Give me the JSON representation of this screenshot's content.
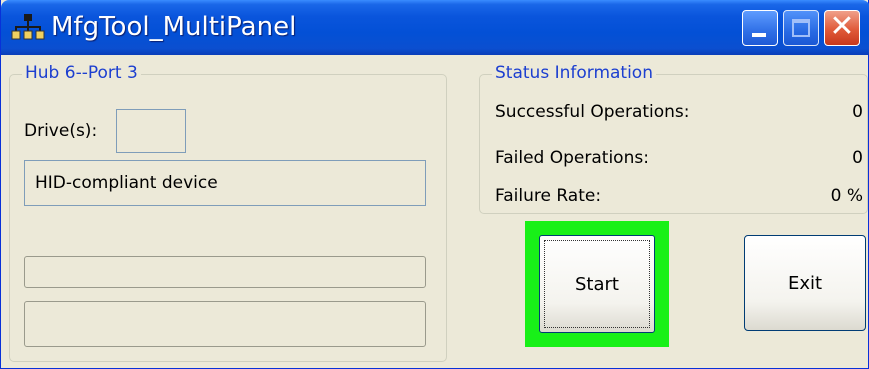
{
  "window": {
    "title": "MfgTool_MultiPanel",
    "close_glyph": "✕"
  },
  "hub_panel": {
    "legend": "Hub 6--Port 3",
    "drive_label": "Drive(s):",
    "drive_value": "",
    "device_name": "HID-compliant device",
    "progress": [
      0,
      0
    ]
  },
  "status": {
    "legend": "Status Information",
    "successful_label": "Successful Operations:",
    "successful_value": "0",
    "failed_label": "Failed Operations:",
    "failed_value": "0",
    "rate_label": "Failure Rate:",
    "rate_value": "0 %"
  },
  "buttons": {
    "start_label": "Start",
    "exit_label": "Exit"
  },
  "colors": {
    "title_bar": "#0350d6",
    "legend_text": "#1c3fd0",
    "start_highlight": "#18f018",
    "close_button": "#e05a3a"
  },
  "icons": {
    "app": "network-hub-icon",
    "minimize": "minimize-icon",
    "maximize": "maximize-icon",
    "close": "close-icon"
  }
}
